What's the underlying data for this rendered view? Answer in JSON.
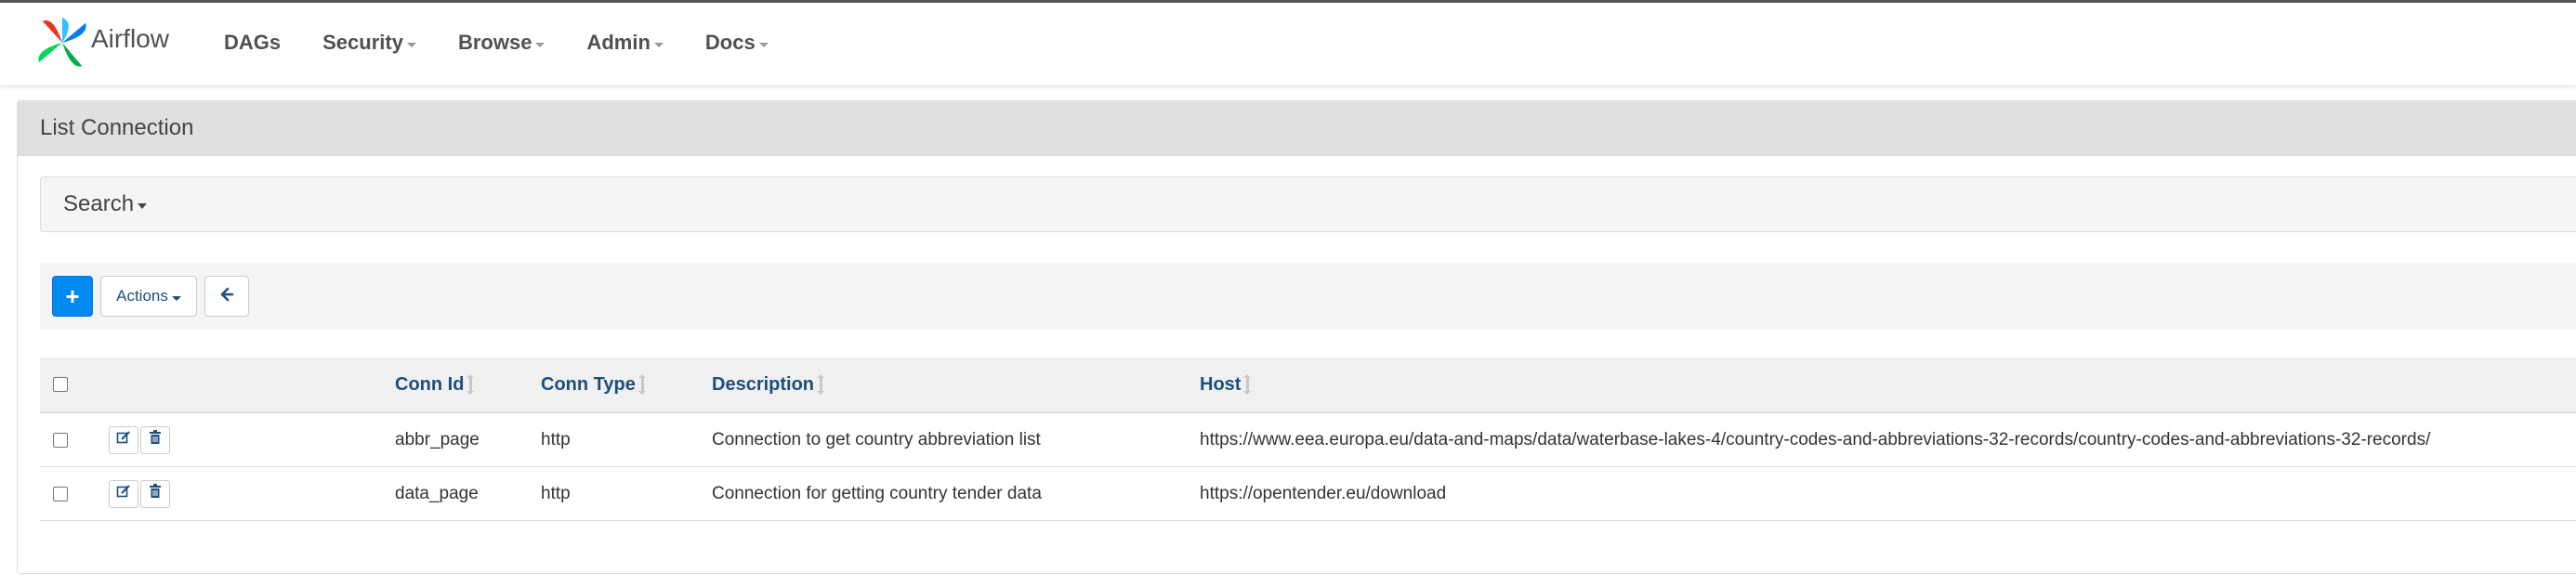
{
  "app": {
    "name": "Airflow",
    "brand_colors": [
      "#e43921",
      "#00ad46",
      "#04d659",
      "#0cb6ff",
      "#017cee"
    ]
  },
  "nav": {
    "items": [
      {
        "label": "DAGs",
        "has_dropdown": false
      },
      {
        "label": "Security",
        "has_dropdown": true
      },
      {
        "label": "Browse",
        "has_dropdown": true
      },
      {
        "label": "Admin",
        "has_dropdown": true
      },
      {
        "label": "Docs",
        "has_dropdown": true
      }
    ]
  },
  "panel": {
    "title": "List Connection",
    "search_label": "Search"
  },
  "toolbar": {
    "add_label": "+",
    "actions_label": "Actions",
    "back_icon": "arrow-left-icon",
    "add_color": "#0089f0"
  },
  "table": {
    "headers": [
      "Conn Id",
      "Conn Type",
      "Description",
      "Host"
    ],
    "rows": [
      {
        "conn_id": "abbr_page",
        "conn_type": "http",
        "description": "Connection to get country abbreviation list",
        "host": "https://www.eea.europa.eu/data-and-maps/data/waterbase-lakes-4/country-codes-and-abbreviations-32-records/country-codes-and-abbreviations-32-records/"
      },
      {
        "conn_id": "data_page",
        "conn_type": "http",
        "description": "Connection for getting country tender data",
        "host": "https://opentender.eu/download"
      }
    ]
  }
}
